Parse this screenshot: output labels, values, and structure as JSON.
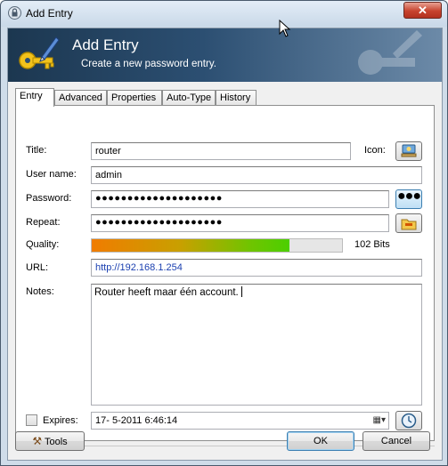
{
  "window": {
    "title": "Add Entry",
    "close_label": "✕"
  },
  "banner": {
    "title": "Add Entry",
    "subtitle": "Create a new password entry."
  },
  "tabs": [
    {
      "label": "Entry",
      "active": true
    },
    {
      "label": "Advanced",
      "active": false
    },
    {
      "label": "Properties",
      "active": false
    },
    {
      "label": "Auto-Type",
      "active": false
    },
    {
      "label": "History",
      "active": false
    }
  ],
  "form": {
    "title_label": "Title:",
    "title_value": "router",
    "icon_label": "Icon:",
    "username_label": "User name:",
    "username_value": "admin",
    "password_label": "Password:",
    "password_value": "●●●●●●●●●●●●●●●●●●●●",
    "show_password_label": "●●●",
    "repeat_label": "Repeat:",
    "repeat_value": "●●●●●●●●●●●●●●●●●●●●",
    "quality_label": "Quality:",
    "quality_fraction": 0.79,
    "quality_text": "102 Bits",
    "url_label": "URL:",
    "url_value": "http://192.168.1.254",
    "notes_label": "Notes:",
    "notes_value": "Router heeft maar één account.",
    "expires_label": "Expires:",
    "expires_checked": false,
    "expires_value": "17- 5-2011   6:46:14"
  },
  "footer": {
    "tools_label": "Tools",
    "ok_label": "OK",
    "cancel_label": "Cancel"
  },
  "colors": {
    "banner_dark": "#1c3750",
    "url_text": "#1a3fb0",
    "quality_start": "#f07c00",
    "quality_end": "#4ccf00"
  }
}
